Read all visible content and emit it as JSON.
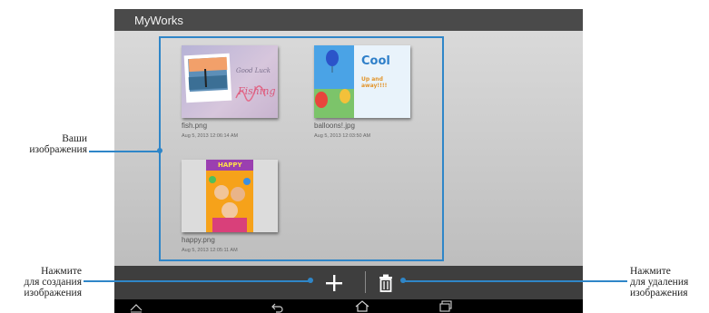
{
  "app": {
    "title": "MyWorks"
  },
  "gallery": {
    "items": [
      {
        "filename": "fish.png",
        "date": "Aug 5, 2013 12:06:14 AM",
        "caption": "Good Luck",
        "handwriting": "Fishing"
      },
      {
        "filename": "balloons!.jpg",
        "date": "Aug 5, 2013 12:03:50 AM",
        "headline": "Cool",
        "tagline": "Up and away!!!!"
      },
      {
        "filename": "happy.png",
        "date": "Aug 5, 2013 12:05:11 AM",
        "banner": "HAPPY"
      }
    ]
  },
  "toolbar": {
    "add_icon": "plus-icon",
    "delete_icon": "trash-icon"
  },
  "navbar": {
    "icons": [
      "up-icon",
      "back-icon",
      "home-icon",
      "recent-apps-icon"
    ]
  },
  "callouts": {
    "images": [
      "Ваши",
      "изображения"
    ],
    "create": [
      "Нажмите",
      "для создания",
      "изображения"
    ],
    "delete": [
      "Нажмите",
      "для удаления",
      "изображения"
    ]
  },
  "colors": {
    "accent": "#2f86c8",
    "titlebar": "#4a4a4a",
    "toolbar": "#3e3e3e"
  }
}
